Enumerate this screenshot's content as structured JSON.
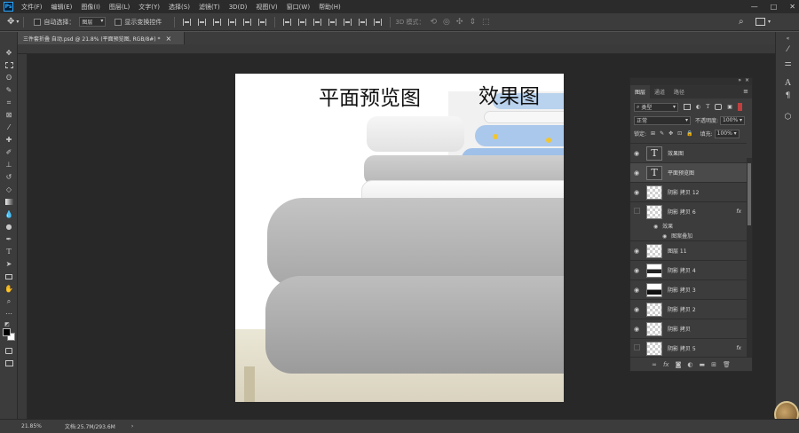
{
  "app": {
    "logo": "Ps"
  },
  "menu": [
    "文件(F)",
    "编辑(E)",
    "图像(I)",
    "图层(L)",
    "文字(Y)",
    "选择(S)",
    "滤镜(T)",
    "3D(D)",
    "视图(V)",
    "窗口(W)",
    "帮助(H)"
  ],
  "window_controls": {
    "minimize": "—",
    "maximize": "□",
    "close": "✕"
  },
  "options": {
    "auto_select_label": "自动选择：",
    "auto_select_value": "图层",
    "show_transform_label": "显示变换控件",
    "mode_3d_label": "3D 模式："
  },
  "document": {
    "tab_title": "三件套折叠 自动.psd @ 21.8% (平面预览图, RGB/8#) *",
    "close_glyph": "×"
  },
  "canvas": {
    "title_preview": "平面预览图",
    "title_effect": "效果图"
  },
  "status": {
    "zoom": "21.85%",
    "doc_size": "文档:25.7M/293.6M"
  },
  "layers_panel": {
    "tabs": [
      "图层",
      "通道",
      "路径"
    ],
    "filter_label": "类型",
    "blend_mode": "正常",
    "opacity_label": "不透明度:",
    "opacity_value": "100%",
    "lock_label": "锁定:",
    "fill_label": "填充:",
    "fill_value": "100%",
    "layers": [
      {
        "name": "效果图",
        "kind": "text",
        "visible": true
      },
      {
        "name": "平面预览图",
        "kind": "text",
        "visible": true,
        "selected": true
      },
      {
        "name": "阴影 拷贝 12",
        "kind": "pixel",
        "visible": true
      },
      {
        "name": "阴影 拷贝 6",
        "kind": "pixel",
        "visible": false,
        "fx": "fx"
      },
      {
        "name": "图层 11",
        "kind": "pixel",
        "visible": true
      },
      {
        "name": "阴影 拷贝 4",
        "kind": "pixel",
        "visible": true
      },
      {
        "name": "阴影 拷贝 3",
        "kind": "pixel",
        "visible": true
      },
      {
        "name": "阴影 拷贝 2",
        "kind": "pixel",
        "visible": true
      },
      {
        "name": "阴影 拷贝",
        "kind": "pixel",
        "visible": true
      },
      {
        "name": "阴影 拷贝 5",
        "kind": "pixel",
        "visible": false,
        "fx": "fx"
      }
    ],
    "effects_label": "效果",
    "pattern_overlay_label": "图案叠加"
  }
}
